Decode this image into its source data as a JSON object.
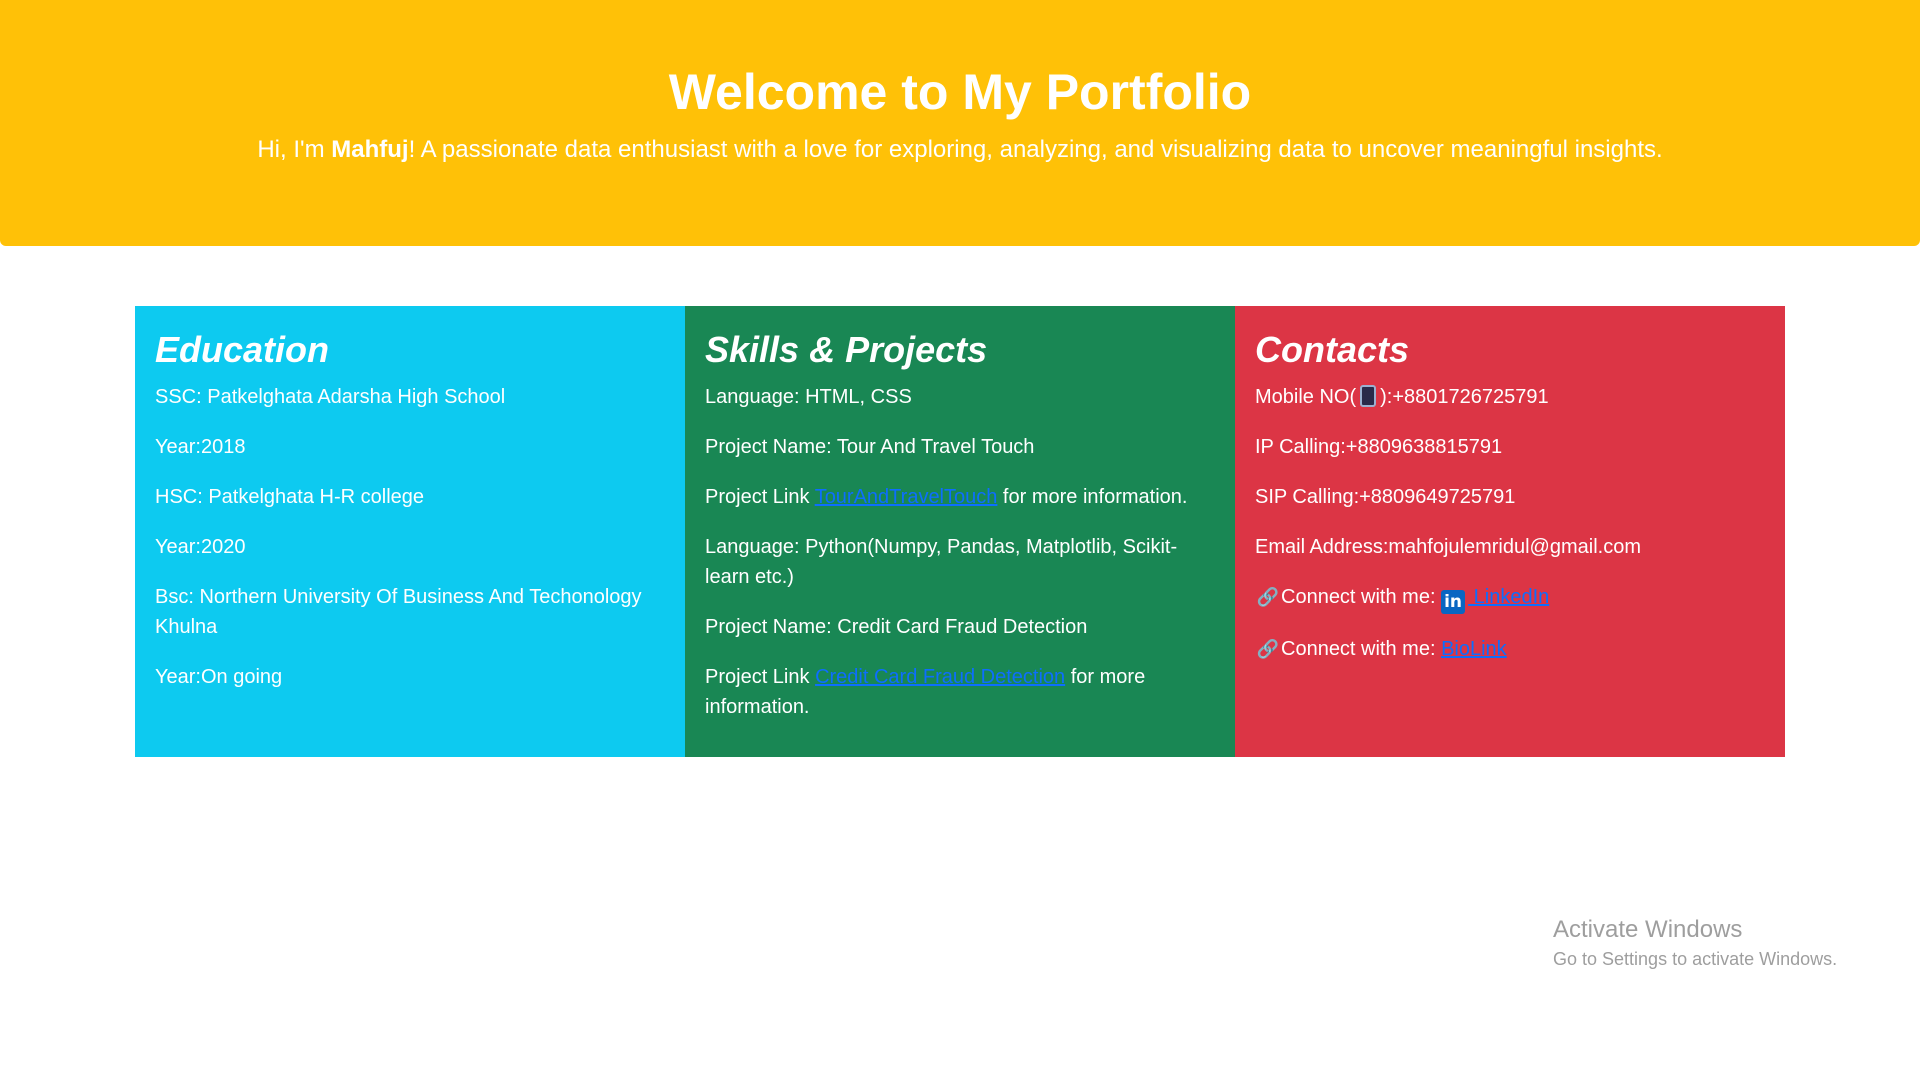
{
  "hero": {
    "title": "Welcome to My Portfolio",
    "intro_prefix": "Hi, I'm ",
    "name": "Mahfuj",
    "intro_suffix": "! A passionate data enthusiast with a love for exploring, analyzing, and visualizing data to uncover meaningful insights.",
    "background_color": "#ffc107"
  },
  "education": {
    "heading": "Education",
    "background_color": "#0dcaf0",
    "items": [
      "SSC: Patkelghata Adarsha High School",
      "Year:2018",
      "HSC: Patkelghata H-R college",
      "Year:2020",
      "Bsc: Northern University Of Business And Techonology Khulna",
      "Year:On going"
    ]
  },
  "skills": {
    "heading": "Skills & Projects",
    "background_color": "#198754",
    "language_1": "Language: HTML, CSS",
    "project_1_name": "Project Name: Tour And Travel Touch",
    "project_1_link_prefix": "Project Link ",
    "project_1_link_text": "TourAndTravelTouch",
    "project_1_link_suffix": " for more information.",
    "language_2": "Language: Python(Numpy, Pandas, Matplotlib, Scikit-learn etc.)",
    "project_2_name": "Project Name: Credit Card Fraud Detection",
    "project_2_link_prefix": "Project Link ",
    "project_2_link_text": "Credit Card Fraud Detection",
    "project_2_link_suffix": " for more information."
  },
  "contacts": {
    "heading": "Contacts",
    "background_color": "#dc3545",
    "mobile_prefix": "Mobile NO(",
    "mobile_icon": "mobile-phone-icon",
    "mobile_suffix": "):+8801726725791",
    "ip_calling": "IP Calling:+8809638815791",
    "sip_calling": "SIP Calling:+8809649725791",
    "email": "Email Address:mahfojulemridul@gmail.com",
    "connect_label": "Connect with me: ",
    "linkedin_icon": "linkedin-icon",
    "linkedin_text": " LinkedIn",
    "biolink_text": "BioLink",
    "link_color": "#0d6efd"
  },
  "watermark": {
    "line1": "Activate Windows",
    "line2": "Go to Settings to activate Windows."
  }
}
